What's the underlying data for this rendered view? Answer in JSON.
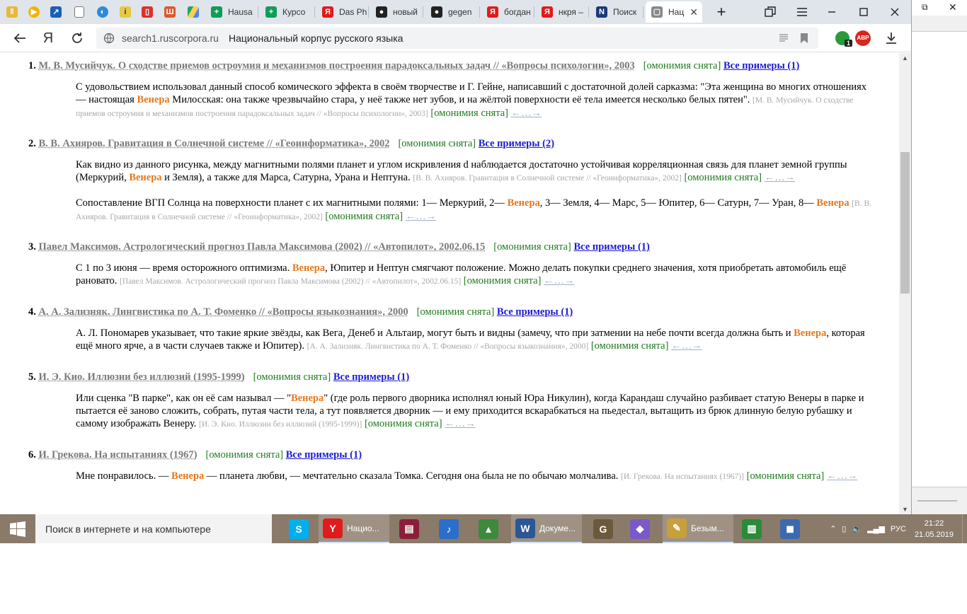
{
  "browser": {
    "tabs": [
      {
        "label": "Hausa",
        "color": "#0f9d58",
        "glyph": "+"
      },
      {
        "label": "Курсо",
        "color": "#0f9d58",
        "glyph": "+"
      },
      {
        "label": "Das Ph",
        "color": "#e01b1b",
        "glyph": "Я"
      },
      {
        "label": "новый",
        "color": "#222222",
        "glyph": "●"
      },
      {
        "label": "gegen",
        "color": "#222222",
        "glyph": "●"
      },
      {
        "label": "богдан",
        "color": "#e01b1b",
        "glyph": "Я"
      },
      {
        "label": "нкря –",
        "color": "#e01b1b",
        "glyph": "Я"
      },
      {
        "label": "Поиск",
        "color": "#1b3a7a",
        "glyph": "N"
      },
      {
        "label": "Нац",
        "color": "#888888",
        "glyph": "▢"
      }
    ],
    "address": {
      "domain": "search1.ruscorpora.ru",
      "title": "Национальный корпус русского языка"
    },
    "abp_label": "ABP",
    "ext_badge": "1"
  },
  "results": [
    {
      "num": "1.",
      "title": "М. В. Мусийчук. О сходстве приемов остроумия и механизмов построения парадоксальных задач // «Вопросы психологии», 2003",
      "homonymy": "[омонимия снята]",
      "all_examples": "Все примеры (1)",
      "snippets": [
        {
          "before": "С удовольствием использовал данный способ комического эффекта в своём творчестве и Г. Гейне, написавший с достаточной долей сарказма: \"Эта женщина во многих отношениях — настоящая ",
          "keyword": "Венера",
          "after": " Милосская: она также чрезвычайно стара, у неё также нет зубов, и на жёлтой поверхности её тела имеется несколько белых пятен\". ",
          "source": "[М. В. Мусийчук. О сходстве приемов остроумия и механизмов построения парадоксальных задач // «Вопросы психологии», 2003]",
          "homonymy": "[омонимия снята]",
          "nav": "←…→"
        }
      ]
    },
    {
      "num": "2.",
      "title": "В. В. Ахияров. Гравитация в Солнечной системе // «Геоинформатика», 2002",
      "homonymy": "[омонимия снята]",
      "all_examples": "Все примеры (2)",
      "snippets": [
        {
          "before": "Как видно из данного рисунка, между магнитными полями планет и углом искривления d наблюдается достаточно устойчивая корреляционная связь для планет земной группы (Меркурий, ",
          "keyword": "Венера",
          "after": " и Земля), а также для Марса, Сатурна, Урана и Нептуна. ",
          "source": "[В. В. Ахияров. Гравитация в Солнечной системе // «Геоинформатика», 2002]",
          "homonymy": "[омонимия снята]",
          "nav": "←…→"
        },
        {
          "before": "Сопоставление ВГП Солнца на поверхности планет с их магнитными полями: 1— Меркурий, 2— ",
          "keyword": "Венера",
          "after": ", 3— Земля, 4— Марс, 5— Юпитер, 6— Сатурн, 7— Уран, 8— ",
          "keyword2": "Венера",
          "after2": " ",
          "source": "[В. В. Ахияров. Гравитация в Солнечной системе // «Геоинформатика», 2002]",
          "homonymy": "[омонимия снята]",
          "nav": "←…→"
        }
      ]
    },
    {
      "num": "3.",
      "title": "Павел Максимов. Астрологический прогноз Павла Максимова (2002) // «Автопилот», 2002.06.15",
      "homonymy": "[омонимия снята]",
      "all_examples": "Все примеры (1)",
      "snippets": [
        {
          "before": "С 1 по 3 июня — время осторожного оптимизма. ",
          "keyword": "Венера",
          "after": ", Юпитер и Нептун смягчают положение. Можно делать покупки среднего значения, хотя приобретать автомобиль ещё рановато. ",
          "source": "[Павел Максимов. Астрологический прогноз Павла Максимова (2002) // «Автопилот», 2002.06.15]",
          "homonymy": "[омонимия снята]",
          "nav": "←…→"
        }
      ]
    },
    {
      "num": "4.",
      "title": "А. А. Зализняк. Лингвистика по А. Т. Фоменко // «Вопросы языкознания», 2000",
      "homonymy": "[омонимия снята]",
      "all_examples": "Все примеры (1)",
      "snippets": [
        {
          "before": "А. Л. Пономарев указывает, что такие яркие звёзды, как Вега, Денеб и Альтаир, могут быть и видны (замечу, что при затмении на небе почти всегда должна быть и ",
          "keyword": "Венера",
          "after": ", которая ещё много ярче, а в части случаев также и Юпитер). ",
          "source": "[А. А. Зализняк. Лингвистика по А. Т. Фоменко // «Вопросы языкознания», 2000]",
          "homonymy": "[омонимия снята]",
          "nav": "←…→"
        }
      ]
    },
    {
      "num": "5.",
      "title": "И. Э. Кио. Иллюзии без иллюзий (1995-1999)",
      "homonymy": "[омонимия снята]",
      "all_examples": "Все примеры (1)",
      "snippets": [
        {
          "before": "Или сценка \"В парке\", как он её сам называл — \"",
          "keyword": "Венера",
          "after": "\" (где роль первого дворника исполнял юный Юра Никулин), когда Карандаш случайно разбивает статую Венеры в парке и пытается её заново сложить, собрать, путая части тела, а тут появляется дворник — и ему приходится вскарабкаться на пьедестал, вытащить из брюк длинную белую рубашку и самому изображать Венеру. ",
          "source": "[И. Э. Кио. Иллюзии без иллюзий (1995-1999)]",
          "homonymy": "[омонимия снята]",
          "nav": "←…→"
        }
      ]
    },
    {
      "num": "6.",
      "title": "И. Грекова. На испытаниях (1967)",
      "homonymy": "[омонимия снята]",
      "all_examples": "Все примеры (1)",
      "snippets": [
        {
          "before": "Мне понравилось. — ",
          "keyword": "Венера",
          "after": " — планета любви, — мечтательно сказала Томка. Сегодня она была не по обычаю молчалива. ",
          "source": "[И. Грекова. На испытаниях (1967)]",
          "homonymy": "[омонимия снята]",
          "nav": "←…→"
        }
      ]
    }
  ],
  "taskbar": {
    "search_placeholder": "Поиск в интернете и на компьютере",
    "apps": [
      {
        "name": "skype",
        "label": "",
        "color": "#00aff0",
        "glyph": "S"
      },
      {
        "name": "yandex-browser",
        "label": "Нацио...",
        "color": "#e01b1b",
        "glyph": "Y",
        "open": true
      },
      {
        "name": "winrar",
        "label": "",
        "color": "#8b1f3a",
        "glyph": "▤"
      },
      {
        "name": "audio",
        "label": "",
        "color": "#2a6fc9",
        "glyph": "♪"
      },
      {
        "name": "edu-app",
        "label": "",
        "color": "#3c8a3c",
        "glyph": "▲"
      },
      {
        "name": "word",
        "label": "Докуме...",
        "color": "#2b5797",
        "glyph": "W",
        "open": true
      },
      {
        "name": "gimp",
        "label": "",
        "color": "#6b5a3a",
        "glyph": "G"
      },
      {
        "name": "tool",
        "label": "",
        "color": "#7a5ac8",
        "glyph": "◆"
      },
      {
        "name": "paint",
        "label": "Безым...",
        "color": "#c8a03a",
        "glyph": "✎",
        "open": true
      },
      {
        "name": "chart-app",
        "label": "",
        "color": "#2a8a3a",
        "glyph": "▥"
      },
      {
        "name": "network-app",
        "label": "",
        "color": "#3a6ab0",
        "glyph": "◼"
      }
    ],
    "lang": "РУС",
    "time": "21:22",
    "date": "21.05.2019"
  }
}
